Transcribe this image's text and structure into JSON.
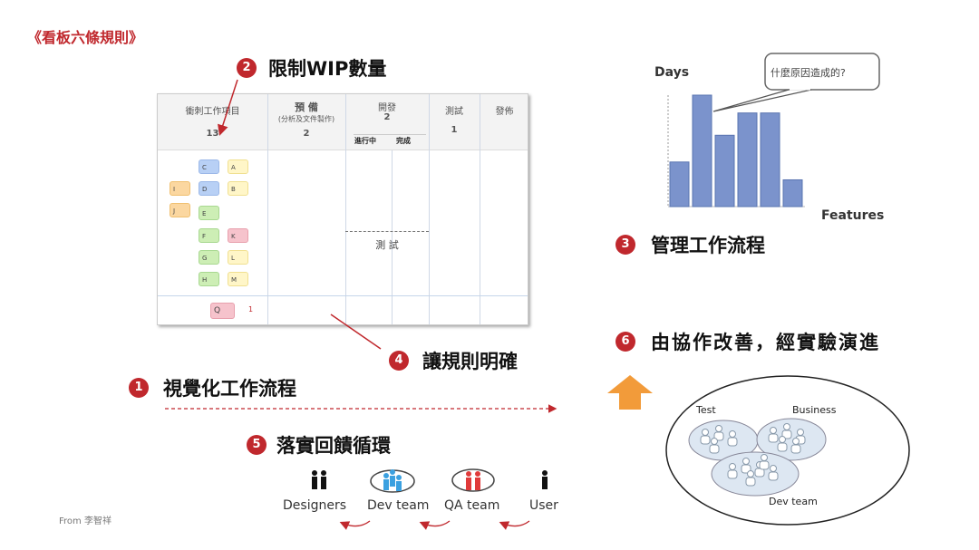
{
  "title": "《看板六條規則》",
  "rules": [
    {
      "n": "1",
      "text": "視覺化工作流程"
    },
    {
      "n": "2",
      "text": "限制WIP數量"
    },
    {
      "n": "3",
      "text": "管理工作流程"
    },
    {
      "n": "4",
      "text": "讓規則明確"
    },
    {
      "n": "5",
      "text": "落實回饋循環"
    },
    {
      "n": "6",
      "text": "由協作改善，經實驗演進"
    }
  ],
  "board": {
    "columns": [
      {
        "name": "衝刺工作項目",
        "limit": "13"
      },
      {
        "name": "預 備",
        "sub": "(分析及文件製作)",
        "limit": "2"
      },
      {
        "name": "開發",
        "limit": "2",
        "subcols": [
          "進行中",
          "完成"
        ]
      },
      {
        "name": "測試",
        "limit": "1"
      },
      {
        "name": "發佈"
      }
    ],
    "dev_test_label": "測 試",
    "cards": [
      "C",
      "A",
      "I",
      "D",
      "B",
      "J",
      "E",
      "F",
      "K",
      "G",
      "L",
      "H",
      "M"
    ],
    "expedite_card": "Q",
    "expedite_limit": "1",
    "card_colors": {
      "blue": "#b8d0f5",
      "yellow": "#fff6c8",
      "orange": "#fbd7a0",
      "green": "#cdeeb5",
      "pink": "#f6c3cc"
    }
  },
  "chart": {
    "ylabel": "Days",
    "xlabel": "Features",
    "callout": "什麼原因造成的?",
    "bars": [
      2,
      5,
      3.2,
      4.2,
      4.2,
      1.2
    ],
    "bar_color": "#7b93cc"
  },
  "feedback": {
    "roles": [
      "Designers",
      "Dev team",
      "QA team",
      "User"
    ]
  },
  "collab": {
    "groups": [
      "Test",
      "Business",
      "Dev team"
    ]
  },
  "credit": "From 李智祥",
  "accent": "#c0282d"
}
